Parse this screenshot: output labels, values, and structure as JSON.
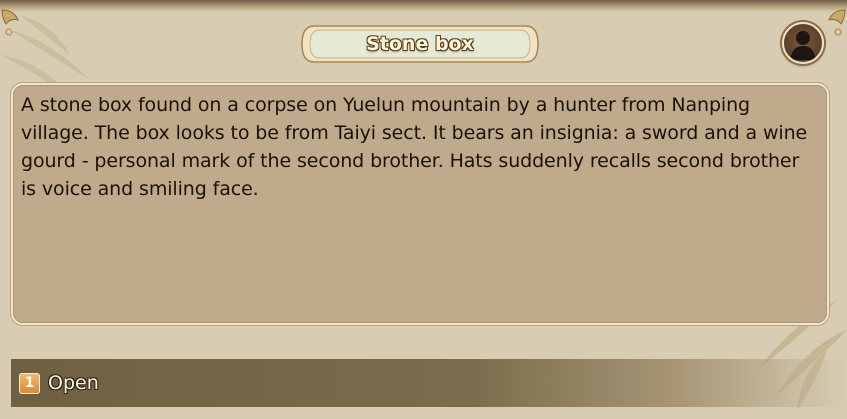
{
  "dialog": {
    "title": "Stone box",
    "description": "A stone box found on a corpse on Yuelun mountain by a hunter from Nanping village. The box looks to be from Taiyi sect. It bears an insignia: a sword and a wine gourd - personal mark of the second brother. Hats suddenly recalls second brother is voice and smiling face."
  },
  "avatar": {
    "icon": "character-portrait-icon"
  },
  "choices": [
    {
      "index": "1",
      "label": "Open"
    }
  ],
  "colors": {
    "background": "#d8cdb2",
    "panel": "#bfab8b",
    "title_plate": "#e8ecd8",
    "choice_bar": "#6e6040",
    "choice_index": "#e49a4a"
  }
}
